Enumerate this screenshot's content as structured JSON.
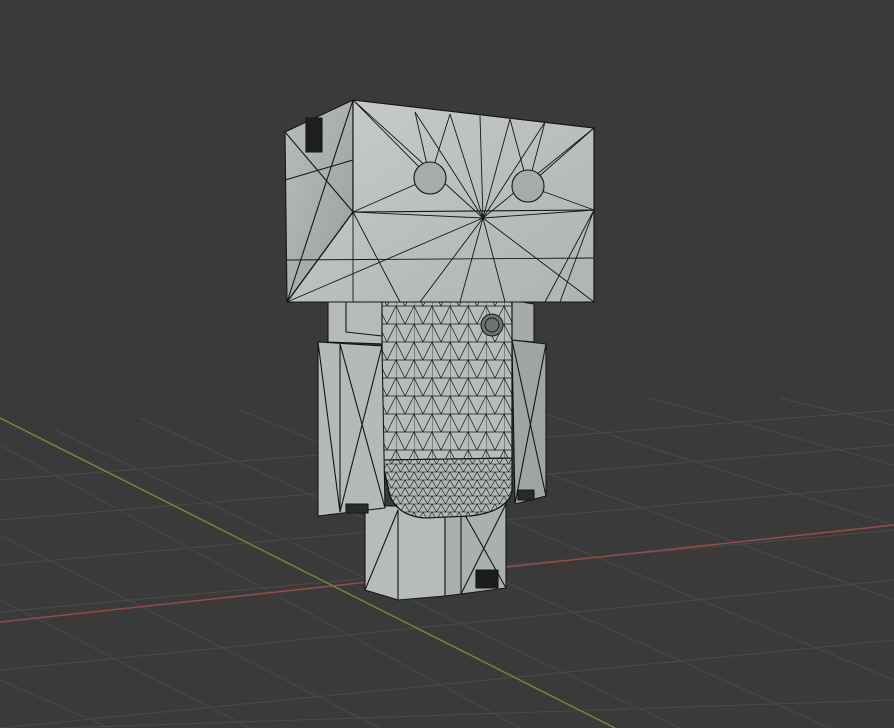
{
  "app": {
    "name": "",
    "view": "3D Viewport"
  },
  "viewport": {
    "shading": "wireframe-overlay",
    "object": "box-robot-mesh"
  },
  "colors": {
    "background": "#3a3a3a",
    "grid": "#4b4b4b",
    "x_axis": "#9b4848",
    "y_axis": "#6d8a3b",
    "mesh_fill": "#b8bdbc",
    "mesh_shadow": "#9ea5a3",
    "mesh_dark": "#8e9593",
    "wire": "#161616"
  }
}
